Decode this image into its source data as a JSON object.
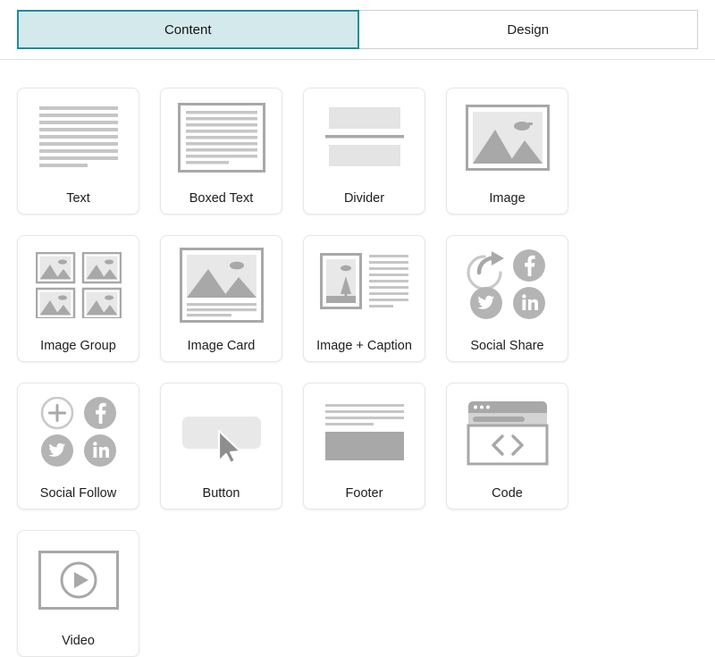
{
  "tabs": [
    {
      "label": "Content",
      "active": true,
      "name": "tab-content"
    },
    {
      "label": "Design",
      "active": false,
      "name": "tab-design"
    }
  ],
  "colors": {
    "tab_active_fill": "#d4e9ec",
    "tab_active_border": "#1a8d9e",
    "tab_border": "#cfcfcf",
    "card_border": "#e6e6e6",
    "art_gray": "#a8a8a8",
    "art_light_gray": "#d6d6d6",
    "art_pale_gray": "#e8e8e8",
    "label_text": "#1d1d1d",
    "page_background": "#ffffff"
  },
  "blocks": [
    {
      "label": "Text",
      "icon": "text-lines-icon"
    },
    {
      "label": "Boxed Text",
      "icon": "boxed-text-icon"
    },
    {
      "label": "Divider",
      "icon": "divider-icon"
    },
    {
      "label": "Image",
      "icon": "image-icon"
    },
    {
      "label": "Image Group",
      "icon": "image-group-icon"
    },
    {
      "label": "Image Card",
      "icon": "image-card-icon"
    },
    {
      "label": "Image + Caption",
      "icon": "image-caption-icon"
    },
    {
      "label": "Social Share",
      "icon": "social-share-icon"
    },
    {
      "label": "Social Follow",
      "icon": "social-follow-icon"
    },
    {
      "label": "Button",
      "icon": "button-cursor-icon"
    },
    {
      "label": "Footer",
      "icon": "footer-icon"
    },
    {
      "label": "Code",
      "icon": "code-browser-icon"
    },
    {
      "label": "Video",
      "icon": "video-play-icon"
    }
  ]
}
